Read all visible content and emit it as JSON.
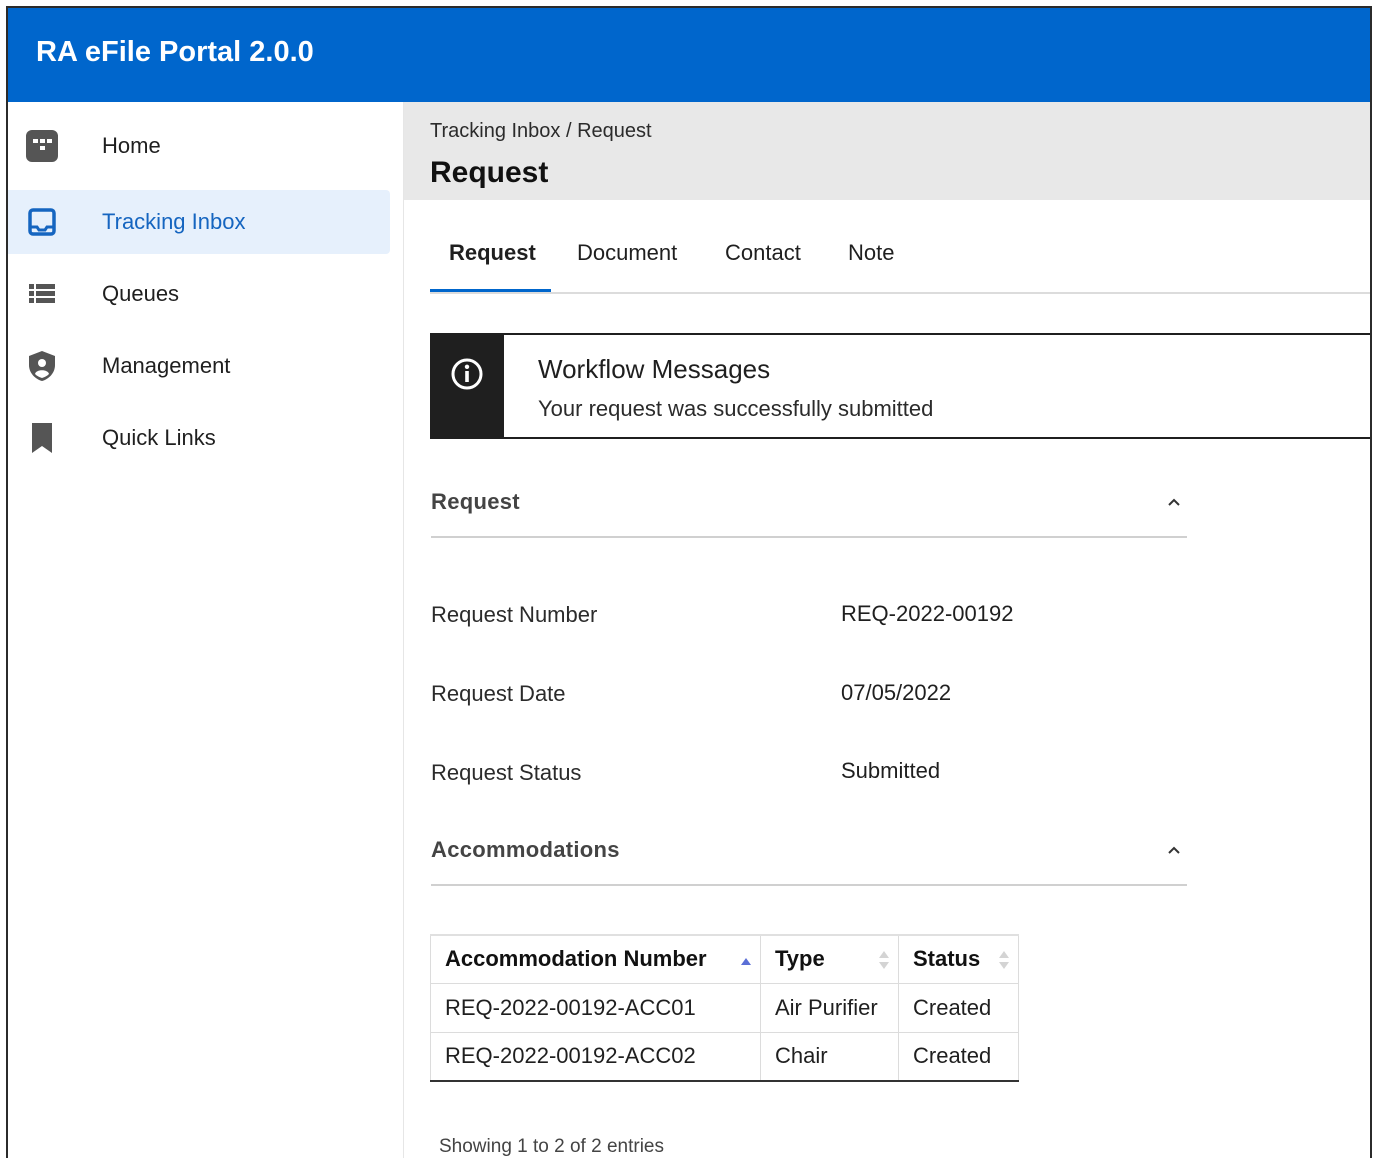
{
  "app": {
    "title": "RA eFile Portal 2.0.0",
    "brand_color": "#0066cc"
  },
  "sidebar": {
    "items": [
      {
        "label": "Home",
        "icon": "home-grid-icon"
      },
      {
        "label": "Tracking Inbox",
        "icon": "inbox-icon",
        "active": true
      },
      {
        "label": "Queues",
        "icon": "list-icon"
      },
      {
        "label": "Management",
        "icon": "shield-user-icon"
      },
      {
        "label": "Quick Links",
        "icon": "bookmark-icon"
      }
    ]
  },
  "header": {
    "breadcrumb": "Tracking Inbox / Request",
    "title": "Request"
  },
  "tabs": [
    {
      "label": "Request",
      "active": true
    },
    {
      "label": "Document"
    },
    {
      "label": "Contact"
    },
    {
      "label": "Note"
    }
  ],
  "alert": {
    "icon": "info-icon",
    "title": "Workflow Messages",
    "message": "Your request was successfully submitted"
  },
  "request_section": {
    "title": "Request",
    "fields": [
      {
        "label": "Request Number",
        "value": "REQ-2022-00192"
      },
      {
        "label": "Request Date",
        "value": "07/05/2022"
      },
      {
        "label": "Request Status",
        "value": "Submitted"
      }
    ]
  },
  "accommodations_section": {
    "title": "Accommodations",
    "columns": [
      "Accommodation Number",
      "Type",
      "Status"
    ],
    "rows": [
      [
        "REQ-2022-00192-ACC01",
        "Air Purifier",
        "Created"
      ],
      [
        "REQ-2022-00192-ACC02",
        "Chair",
        "Created"
      ]
    ],
    "entries_text": "Showing 1 to 2 of 2 entries"
  }
}
